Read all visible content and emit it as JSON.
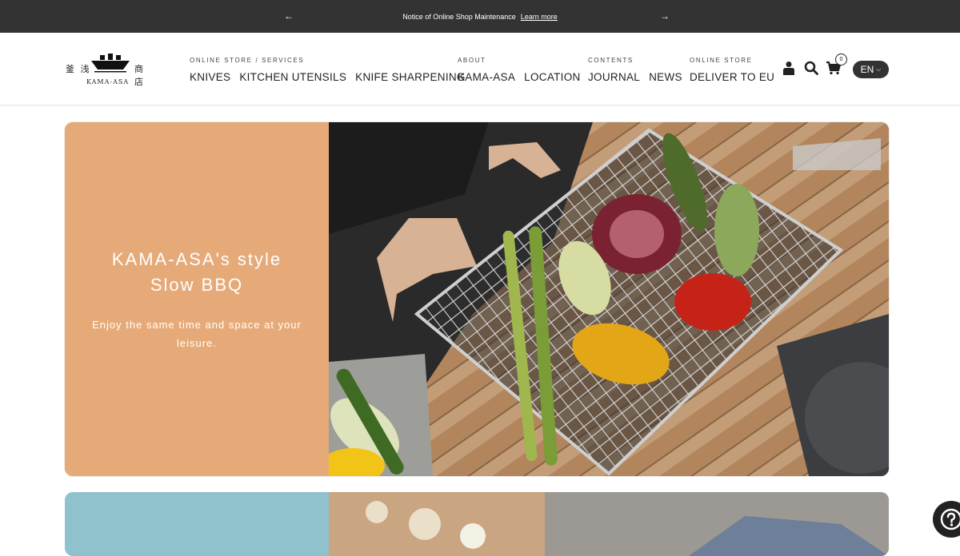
{
  "announcement": {
    "message": "Notice of Online Shop Maintenance",
    "link": "Learn more"
  },
  "logo": {
    "kanji_left": "釜 浅",
    "kanji_right": "商 店",
    "wordmark": "KAMA-ASA"
  },
  "nav": [
    {
      "category": "ONLINE STORE / SERVICES",
      "links": [
        "KNIVES",
        "KITCHEN UTENSILS",
        "KNIFE SHARPENING"
      ]
    },
    {
      "category": "ABOUT",
      "links": [
        "KAMA-ASA",
        "LOCATION"
      ]
    },
    {
      "category": "CONTENTS",
      "links": [
        "JOURNAL",
        "NEWS"
      ]
    },
    {
      "category": "ONLINE STORE",
      "links": [
        "DELIVER TO EU"
      ]
    }
  ],
  "header_icons": [
    "account-icon",
    "search-icon",
    "cart-icon"
  ],
  "cart_count": "0",
  "language": "EN",
  "hero": {
    "title_line1": "KAMA-ASA's style",
    "title_line2": "Slow BBQ",
    "subtitle": "Enjoy the same time and space at your leisure.",
    "bg_color": "#e6aa79"
  },
  "card2": {
    "bg_color": "#8fc2cc"
  }
}
